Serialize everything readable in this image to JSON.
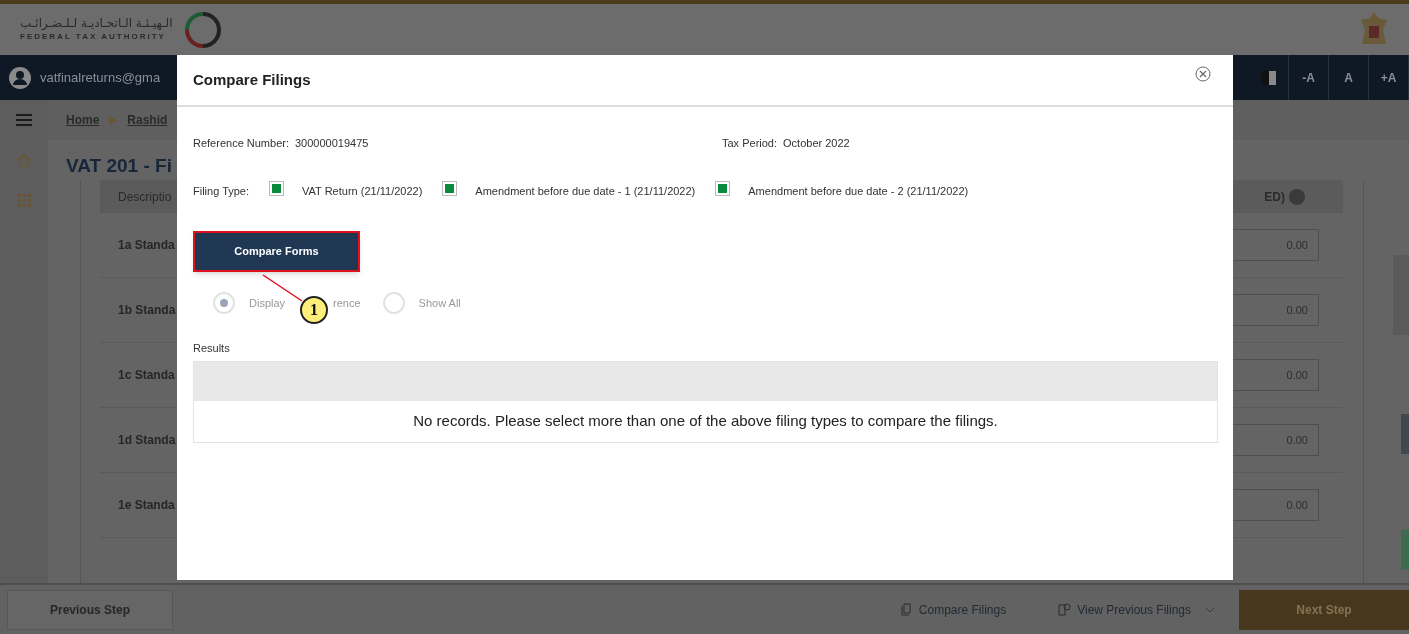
{
  "header": {
    "arabic_name": "الـهيـئـة الـاتحـاديـة لـلـضـرائـب",
    "english_name": "FEDERAL TAX AUTHORITY"
  },
  "nav": {
    "user_email": "vatfinalreturns@gma",
    "font_buttons": [
      "-A",
      "A",
      "+A"
    ]
  },
  "breadcrumb": [
    "Home",
    "Rashid"
  ],
  "page": {
    "title": "VAT 201 - Fi",
    "column_1": "Descriptio",
    "column_2": "ED)"
  },
  "rows": [
    {
      "label": "1a Standa",
      "amount": "0.00"
    },
    {
      "label": "1b Standa",
      "amount": "0.00"
    },
    {
      "label": "1c Standa",
      "amount": "0.00"
    },
    {
      "label": "1d Standa",
      "amount": "0.00"
    },
    {
      "label": "1e Standa",
      "amount": "0.00"
    }
  ],
  "modal": {
    "title": "Compare Filings",
    "reference_label": "Reference Number:",
    "reference_value": "300000019475",
    "period_label": "Tax Period:",
    "period_value": "October 2022",
    "filing_type_label": "Filing Type:",
    "filing_types": [
      {
        "label": "VAT Return (21/11/2022)",
        "checked": true
      },
      {
        "label": "Amendment before due date - 1 (21/11/2022)",
        "checked": true
      },
      {
        "label": "Amendment before due date - 2 (21/11/2022)",
        "checked": true
      }
    ],
    "compare_button": "Compare Forms",
    "view_options": [
      {
        "labels": [
          "Display",
          "rence"
        ],
        "selected": true
      },
      {
        "labels": [
          "Show All"
        ],
        "selected": false
      }
    ],
    "results_label": "Results",
    "empty_message": "No records. Please select more than one of the above filing types to compare the filings."
  },
  "callout": {
    "number": "1"
  },
  "footer": {
    "previous": "Previous Step",
    "compare": "Compare Filings",
    "view_previous": "View Previous Filings",
    "next": "Next Step"
  }
}
